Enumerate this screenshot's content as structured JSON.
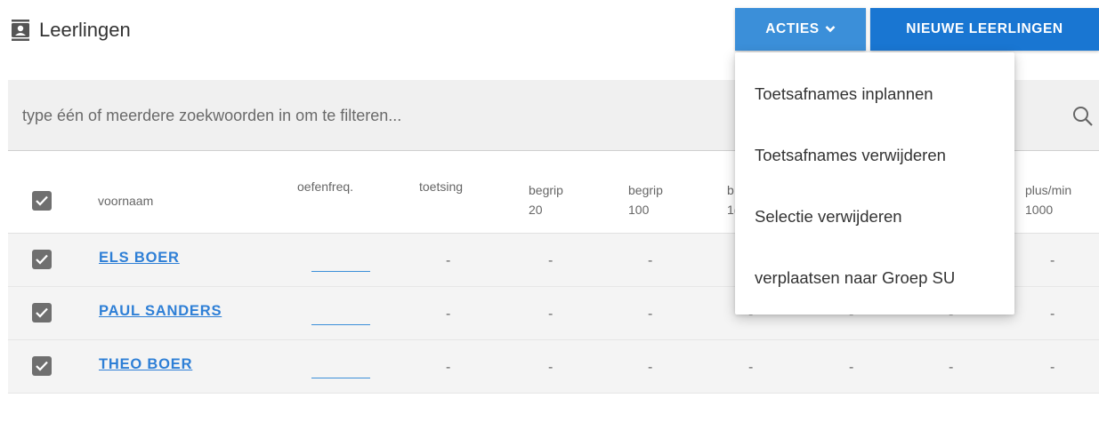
{
  "header": {
    "title": "Leerlingen",
    "icon": "contact-card-icon"
  },
  "toolbar": {
    "acties_label": "ACTIES",
    "nieuwe_label": "NIEUWE LEERLINGEN"
  },
  "search": {
    "placeholder": "type één of meerdere zoekwoorden in om te filteren..."
  },
  "table": {
    "headers": [
      {
        "line1": "voornaam",
        "line2": ""
      },
      {
        "line1": "oefenfreq.",
        "line2": ""
      },
      {
        "line1": "toetsing",
        "line2": ""
      },
      {
        "line1": "begrip",
        "line2": "20"
      },
      {
        "line1": "begrip",
        "line2": "100"
      },
      {
        "line1": "b",
        "line2": "1("
      },
      {
        "line1": "plus/min",
        "line2": "1000"
      }
    ],
    "rows": [
      {
        "name": "ELS BOER",
        "values": [
          "-",
          "-",
          "-",
          "-"
        ]
      },
      {
        "name": "PAUL SANDERS",
        "values": [
          "-",
          "-",
          "-",
          "-",
          "-",
          "-",
          "-"
        ]
      },
      {
        "name": "THEO BOER",
        "values": [
          "-",
          "-",
          "-",
          "-",
          "-",
          "-",
          "-"
        ]
      }
    ]
  },
  "menu": {
    "items": [
      "Toetsafnames inplannen",
      "Toetsafnames verwijderen",
      "Selectie verwijderen",
      "verplaatsen naar Groep SU"
    ]
  },
  "colors": {
    "primary": "#1976d2",
    "acties": "#3b8fd9",
    "link": "#2e7fd6",
    "checkbox": "#6f6f6f"
  }
}
